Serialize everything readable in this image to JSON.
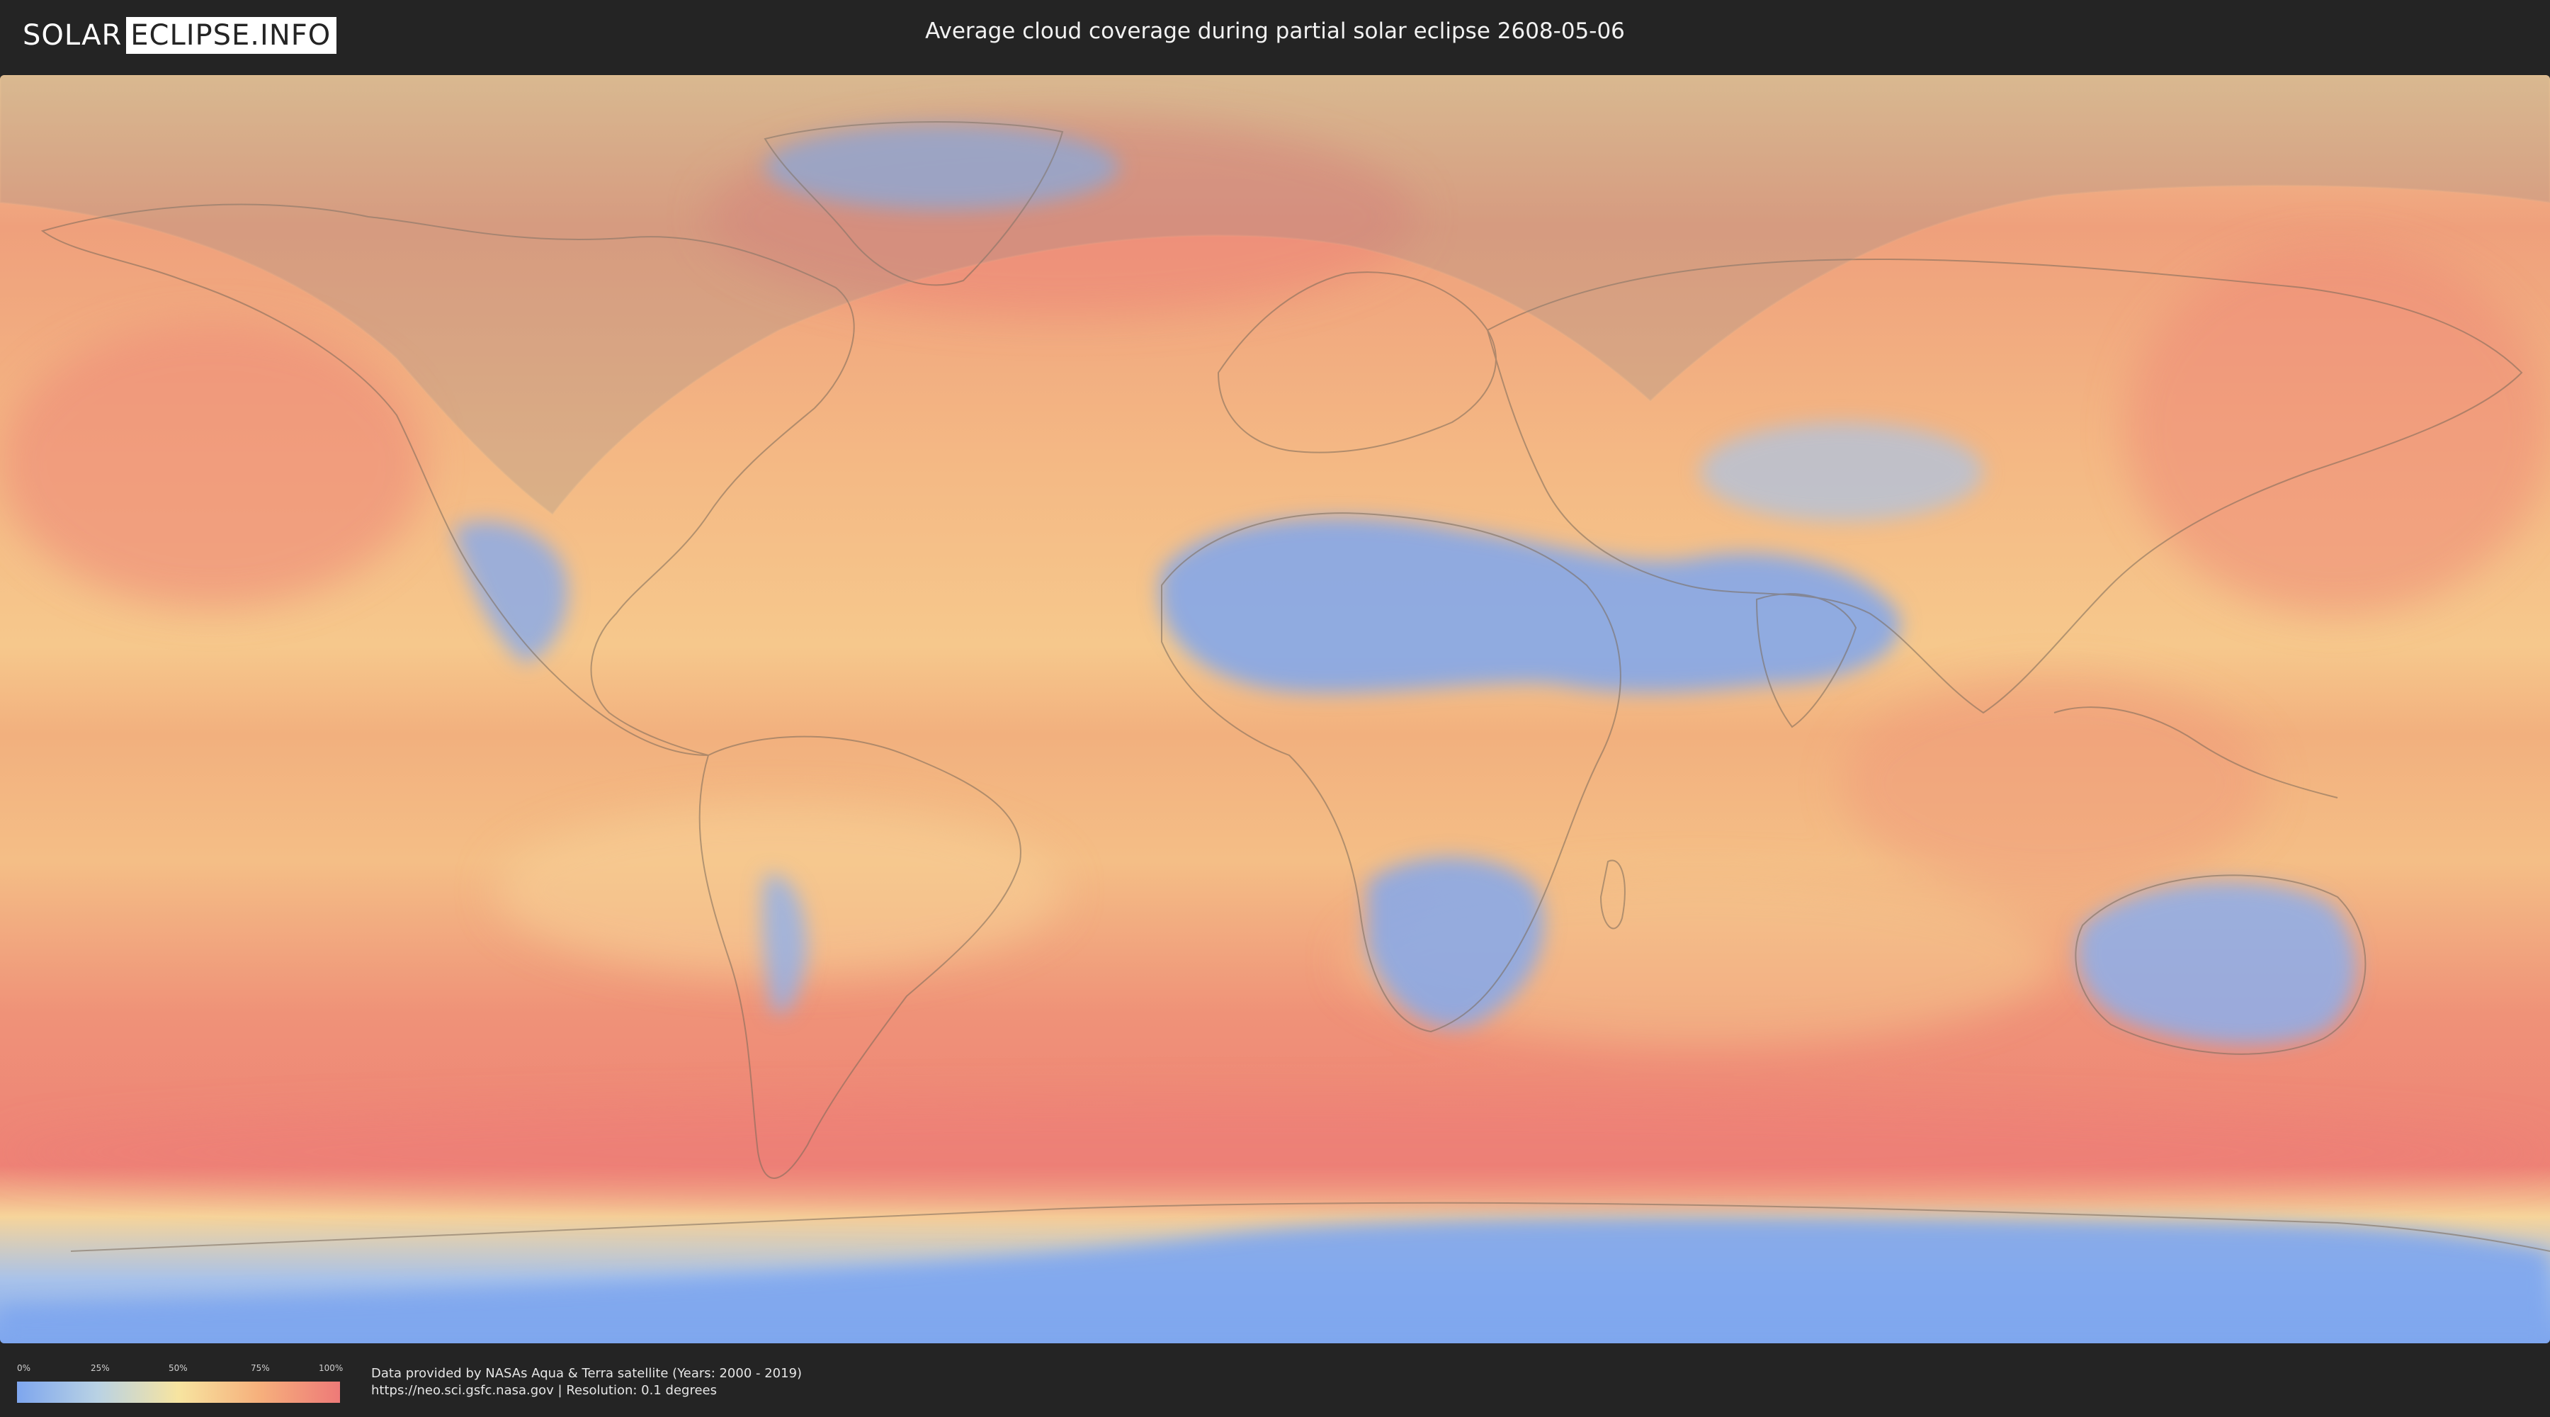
{
  "header": {
    "logo_left": "SOLAR",
    "logo_right": "ECLIPSE.INFO",
    "title": "Average cloud coverage during partial solar eclipse 2608-05-06"
  },
  "map": {
    "description_icon": "world-map-cloud-coverage",
    "colors": {
      "low": "#7ea6ee",
      "mid_low": "#b9d2e4",
      "mid": "#f7e4a0",
      "mid_high": "#f6b07c",
      "high": "#ee7a78",
      "eclipse_overlay": "#8a8a8a"
    }
  },
  "legend": {
    "ticks": [
      "0%",
      "25%",
      "50%",
      "75%",
      "100%"
    ],
    "values": [
      0,
      25,
      50,
      75,
      100
    ]
  },
  "footer": {
    "credit_line1": "Data provided by NASAs Aqua & Terra satellite (Years: 2000 - 2019)",
    "credit_line2": "https://neo.sci.gsfc.nasa.gov | Resolution: 0.1 degrees"
  }
}
